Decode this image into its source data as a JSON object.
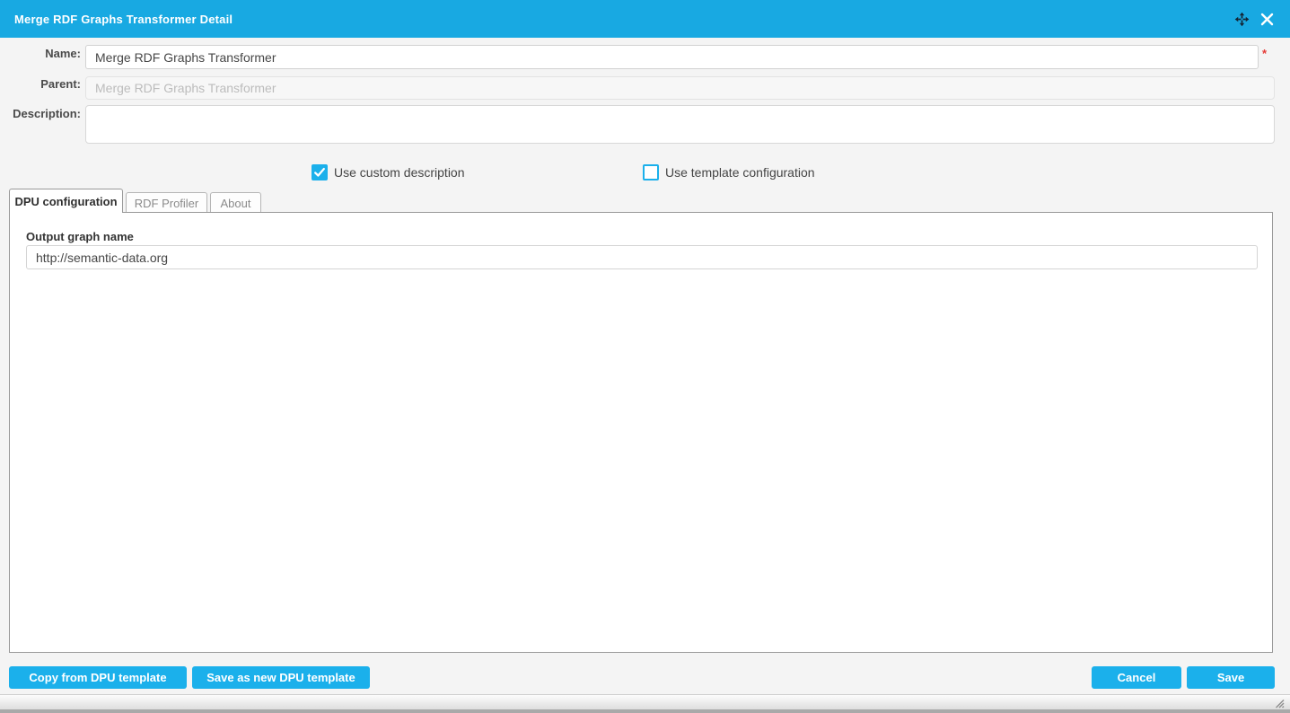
{
  "titlebar": {
    "title": "Merge RDF Graphs Transformer Detail"
  },
  "form": {
    "name": {
      "label": "Name:",
      "value": "Merge RDF Graphs Transformer",
      "required_marker": "*"
    },
    "parent": {
      "label": "Parent:",
      "value": "Merge RDF Graphs Transformer"
    },
    "description": {
      "label": "Description:",
      "value": ""
    }
  },
  "checkboxes": [
    {
      "label": "Use custom description",
      "checked": true
    },
    {
      "label": "Use template configuration",
      "checked": false
    }
  ],
  "tabs": [
    {
      "label": "DPU configuration",
      "active": true
    },
    {
      "label": "RDF Profiler",
      "active": false
    },
    {
      "label": "About",
      "active": false
    }
  ],
  "tab_content": {
    "output_graph_label": "Output graph name",
    "output_graph_value": "http://semantic-data.org"
  },
  "footer": {
    "copy_button": "Copy from DPU template",
    "save_as_new_button": "Save as new DPU template",
    "cancel_button": "Cancel",
    "save_button": "Save"
  },
  "icons": {
    "move": "move-icon",
    "close": "close-icon",
    "check": "checkmark-icon",
    "resize": "resize-grip-icon"
  },
  "colors": {
    "titlebar_blue": "#18a9e2",
    "button_blue": "#1bb0eb",
    "body_bg": "#f4f4f4",
    "panel_border": "#999999",
    "required_red": "#e53935"
  }
}
